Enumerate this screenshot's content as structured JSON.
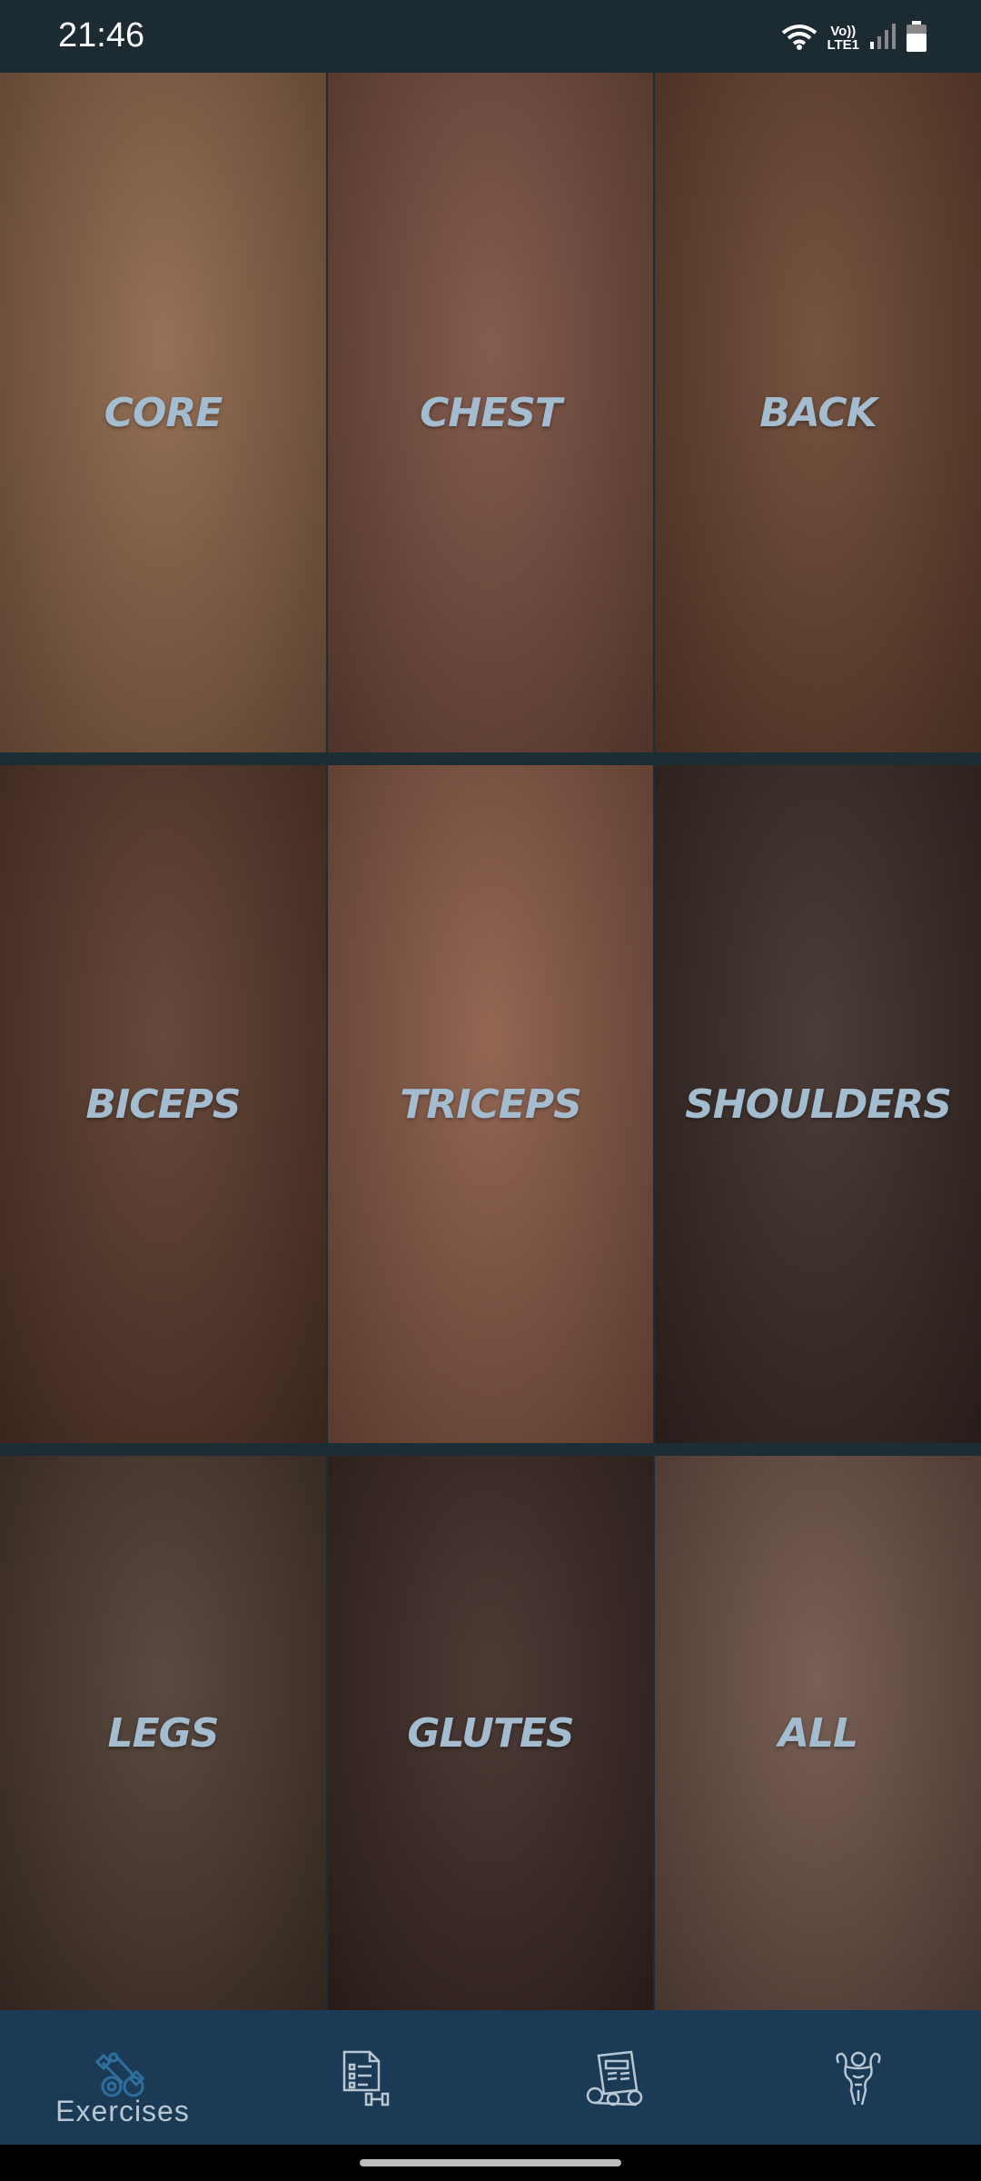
{
  "status_bar": {
    "time": "21:46",
    "network_top": "Vo))",
    "network_bottom": "LTE1",
    "icons": [
      "wifi-icon",
      "signal-icon",
      "battery-icon"
    ]
  },
  "categories": [
    {
      "label": "CORE",
      "bg": "#8d6549"
    },
    {
      "label": "CHEST",
      "bg": "#7a4f3f"
    },
    {
      "label": "BACK",
      "bg": "#6b4530"
    },
    {
      "label": "BICEPS",
      "bg": "#5b3a2b"
    },
    {
      "label": "TRICEPS",
      "bg": "#8a5a45"
    },
    {
      "label": "SHOULDERS",
      "bg": "#3c2c27"
    },
    {
      "label": "LEGS",
      "bg": "#4d3a30"
    },
    {
      "label": "GLUTES",
      "bg": "#3e2a24"
    },
    {
      "label": "ALL",
      "bg": "#6e5247"
    }
  ],
  "bottom_nav": {
    "items": [
      {
        "label": "Exercises",
        "icon": "exercises-icon",
        "active": true
      },
      {
        "label": "",
        "icon": "workout-plan-icon",
        "active": false
      },
      {
        "label": "",
        "icon": "gym-equipment-icon",
        "active": false
      },
      {
        "label": "",
        "icon": "bodybuilder-icon",
        "active": false
      }
    ],
    "active_color": "#2f6f9f",
    "inactive_color": "#b8c7d3"
  }
}
